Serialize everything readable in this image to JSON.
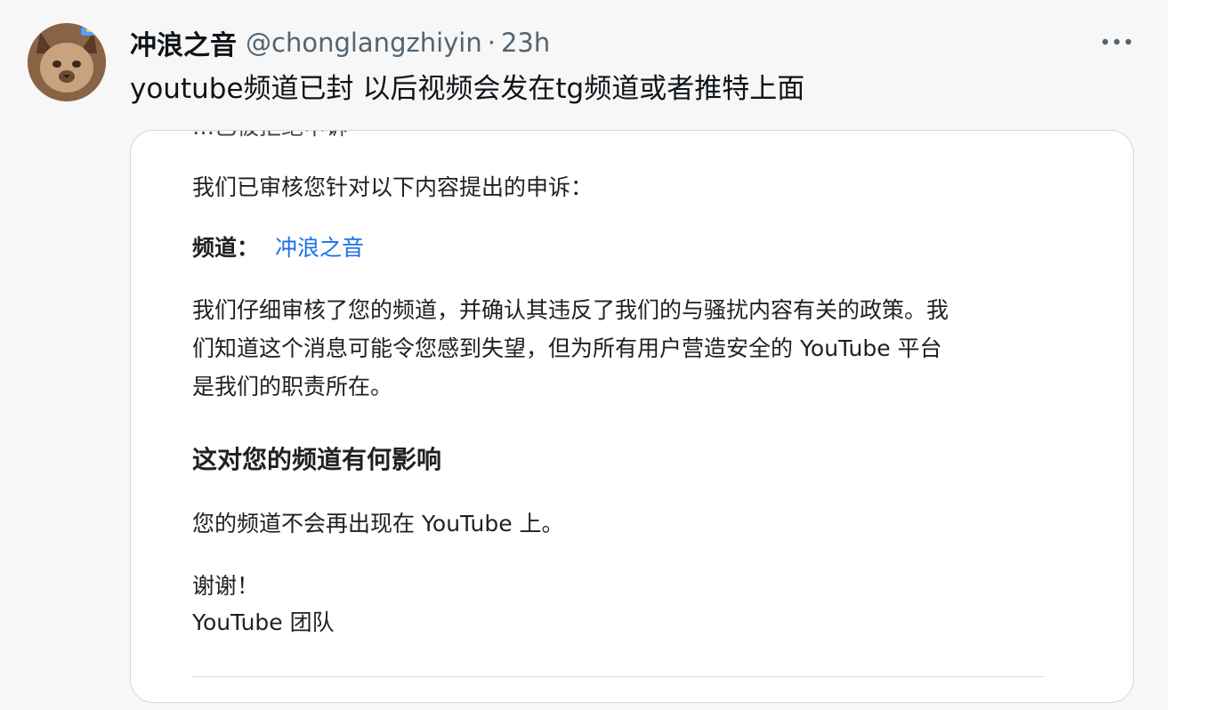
{
  "tweet": {
    "display_name": "冲浪之音",
    "handle": "@chonglangzhiyin",
    "separator": "·",
    "time": "23h",
    "text": "youtube频道已封 以后视频会发在tg频道或者推特上面",
    "more_icon": "more-horizontal-icon"
  },
  "email": {
    "cut_top_line": "…已被拒绝申诉",
    "intro": "我们已审核您针对以下内容提出的申诉：",
    "channel_label": "频道：",
    "channel_name": "冲浪之音",
    "body_lines": [
      "我们仔细审核了您的频道，并确认其违反了我们的与骚扰内容有关的政策。我",
      "们知道这个消息可能令您感到失望，但为所有用户营造安全的 YouTube 平台",
      "是我们的职责所在。"
    ],
    "heading": "这对您的频道有何影响",
    "impact": "您的频道不会再出现在 YouTube 上。",
    "thanks": "谢谢！",
    "signature": "YouTube 团队"
  },
  "colors": {
    "link": "#1a73e8",
    "text_primary": "#0f1419",
    "text_secondary": "#536471",
    "card_border": "#cfd9de"
  }
}
